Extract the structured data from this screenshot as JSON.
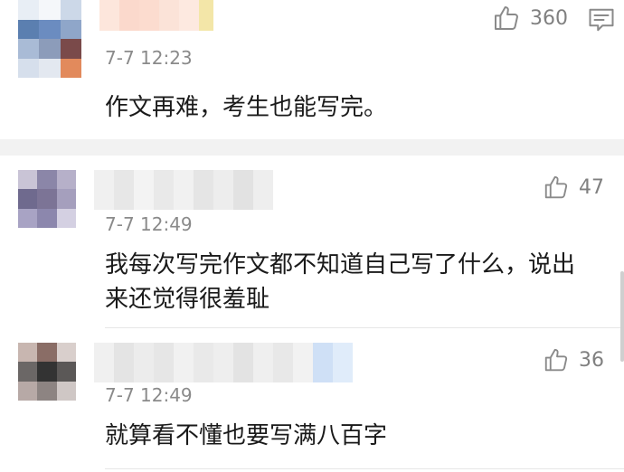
{
  "comments": [
    {
      "time": "7-7 12:23",
      "text": "作文再难，考生也能写完。",
      "likes": "360",
      "name_obscured": true,
      "avatar_obscured": true
    },
    {
      "time": "7-7 12:49",
      "text_line1": "我每次写完作文都不知道自己写了什么，说出",
      "text_line2": "来还觉得很羞耻",
      "likes": "47",
      "name_obscured": true,
      "avatar_obscured": true
    },
    {
      "time": "7-7 12:49",
      "text": "就算看不懂也要写满八百字",
      "likes": "36",
      "name_obscured": true,
      "avatar_obscured": true
    }
  ],
  "icons": {
    "like": "thumbs-up-icon",
    "reply": "comment-bubble-icon"
  },
  "colors": {
    "text": "#1a1a1a",
    "meta": "#8a8a8a",
    "separator": "#f2f2f2"
  }
}
